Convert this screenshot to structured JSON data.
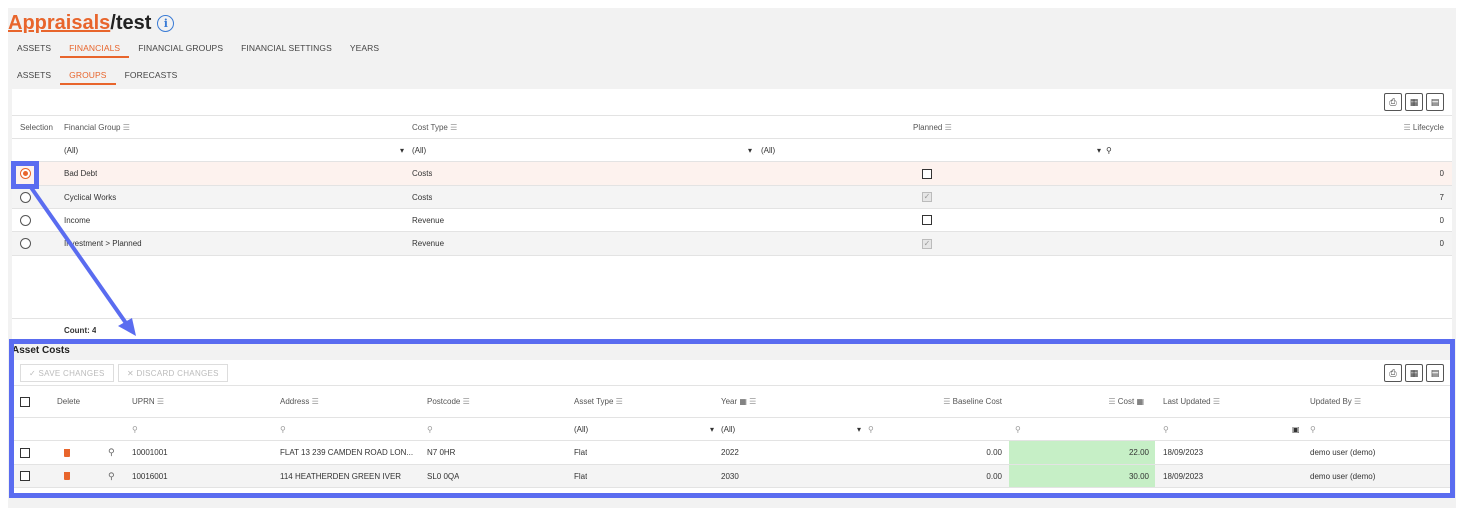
{
  "title": {
    "link": "Appraisals",
    "rest": "/test",
    "info_icon": "info-icon"
  },
  "tabs_main": [
    {
      "label": "ASSETS",
      "active": false
    },
    {
      "label": "FINANCIALS",
      "active": true
    },
    {
      "label": "FINANCIAL GROUPS",
      "active": false
    },
    {
      "label": "FINANCIAL SETTINGS",
      "active": false
    },
    {
      "label": "YEARS",
      "active": false
    }
  ],
  "tabs_sub": [
    {
      "label": "ASSETS",
      "active": false
    },
    {
      "label": "GROUPS",
      "active": true
    },
    {
      "label": "FORECASTS",
      "active": false
    }
  ],
  "groups_grid": {
    "headers": {
      "selection": "Selection",
      "financial_group": "Financial Group",
      "cost_type": "Cost Type",
      "planned": "Planned",
      "lifecycle": "Lifecycle"
    },
    "filters": {
      "financial_group": "(All)",
      "cost_type": "(All)",
      "planned": "(All)"
    },
    "rows": [
      {
        "group": "Bad Debt",
        "cost_type": "Costs",
        "planned": false,
        "lifecycle": "0",
        "selected": true
      },
      {
        "group": "Cyclical Works",
        "cost_type": "Costs",
        "planned": true,
        "lifecycle": "7",
        "selected": false
      },
      {
        "group": "Income",
        "cost_type": "Revenue",
        "planned": false,
        "lifecycle": "0",
        "selected": false
      },
      {
        "group": "Investment > Planned",
        "cost_type": "Revenue",
        "planned": true,
        "lifecycle": "0",
        "selected": false
      }
    ],
    "count": "Count: 4"
  },
  "asset_costs": {
    "title": "Asset Costs",
    "save_label": "SAVE CHANGES",
    "discard_label": "DISCARD CHANGES",
    "headers": {
      "delete": "Delete",
      "uprn": "UPRN",
      "address": "Address",
      "postcode": "Postcode",
      "asset_type": "Asset Type",
      "year": "Year",
      "baseline_cost": "Baseline Cost",
      "cost": "Cost",
      "last_updated": "Last Updated",
      "updated_by": "Updated By"
    },
    "filters": {
      "asset_type": "(All)",
      "year": "(All)"
    },
    "rows": [
      {
        "uprn": "10001001",
        "address": "FLAT 13 239 CAMDEN ROAD LON...",
        "postcode": "N7 0HR",
        "asset_type": "Flat",
        "year": "2022",
        "baseline_cost": "0.00",
        "cost": "22.00",
        "last_updated": "18/09/2023",
        "updated_by": "demo user (demo)"
      },
      {
        "uprn": "10016001",
        "address": "114 HEATHERDEN GREEN IVER",
        "postcode": "SL0 0QA",
        "asset_type": "Flat",
        "year": "2030",
        "baseline_cost": "0.00",
        "cost": "30.00",
        "last_updated": "18/09/2023",
        "updated_by": "demo user (demo)"
      }
    ]
  },
  "colors": {
    "accent": "#e8652c",
    "highlight": "#5a6cf0",
    "cost_cell": "#c6efc6"
  }
}
